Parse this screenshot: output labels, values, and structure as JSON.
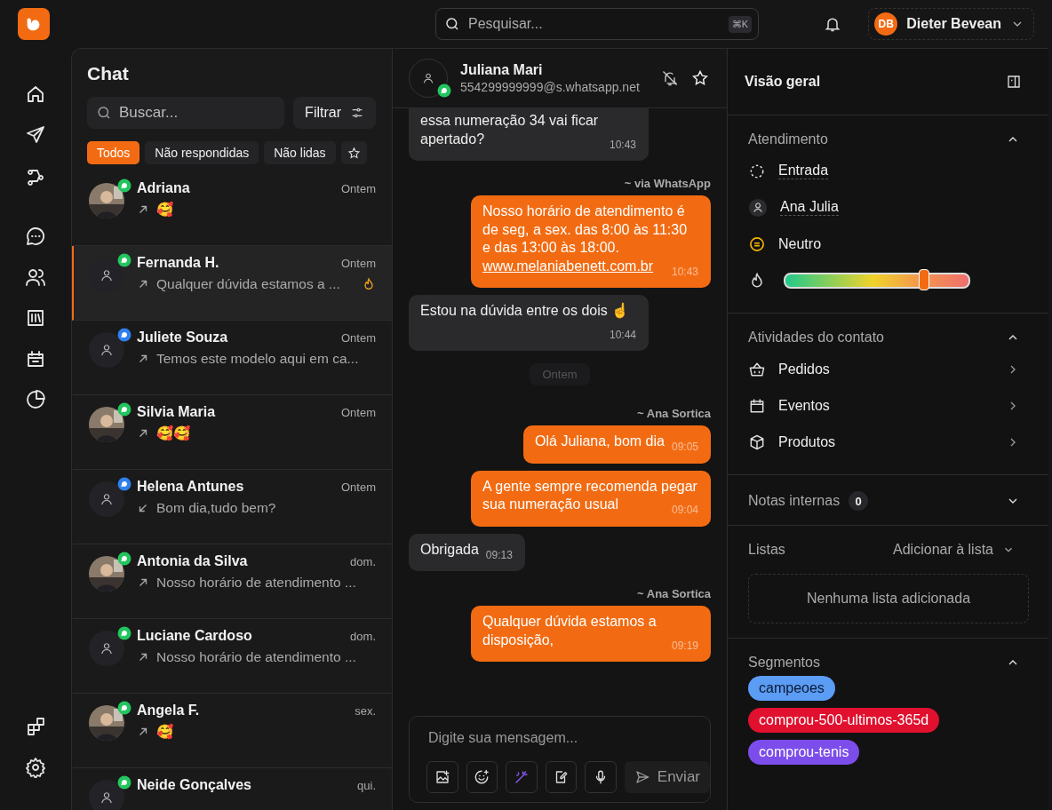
{
  "topbar": {
    "search": {
      "placeholder": "Pesquisar...",
      "shortcut": "⌘K"
    },
    "user": {
      "initials": "DB",
      "name": "Dieter Bevean"
    }
  },
  "chat_list": {
    "title": "Chat",
    "search": {
      "placeholder": "Buscar..."
    },
    "filter_button": "Filtrar",
    "tabs": [
      {
        "kind": "text",
        "label": "Todos",
        "selected": true
      },
      {
        "kind": "text",
        "label": "Não respondidas",
        "selected": false
      },
      {
        "kind": "text",
        "label": "Não lidas",
        "selected": false
      },
      {
        "kind": "starred",
        "selected": false
      }
    ],
    "conversations": [
      {
        "name": "Adriana",
        "time": "Ontem",
        "photo": true,
        "color": "#22c55e",
        "outgoing": true,
        "preview": "🥰",
        "hot": false,
        "selected": false
      },
      {
        "name": "Fernanda H.",
        "time": "Ontem",
        "photo": false,
        "color": "#22c55e",
        "outgoing": true,
        "preview": "Qualquer dúvida estamos a ...",
        "hot": true,
        "selected": true
      },
      {
        "name": "Juliete Souza",
        "time": "Ontem",
        "photo": false,
        "color": "#2f80ed",
        "outgoing": true,
        "preview": "Temos este modelo aqui em ca...",
        "hot": false,
        "selected": false
      },
      {
        "name": "Silvia Maria",
        "time": "Ontem",
        "photo": true,
        "color": "#22c55e",
        "outgoing": true,
        "preview": "🥰🥰",
        "hot": false,
        "selected": false
      },
      {
        "name": "Helena Antunes",
        "time": "Ontem",
        "photo": false,
        "color": "#2f80ed",
        "outgoing": false,
        "preview": "Bom dia,tudo bem?",
        "hot": false,
        "selected": false
      },
      {
        "name": "Antonia da Silva",
        "time": "dom.",
        "photo": true,
        "color": "#22c55e",
        "outgoing": true,
        "preview": "Nosso horário de atendimento ...",
        "hot": false,
        "selected": false
      },
      {
        "name": "Luciane Cardoso",
        "time": "dom.",
        "photo": false,
        "color": "#22c55e",
        "outgoing": true,
        "preview": "Nosso horário de atendimento ...",
        "hot": false,
        "selected": false
      },
      {
        "name": "Angela F.",
        "time": "sex.",
        "photo": true,
        "color": "#22c55e",
        "outgoing": true,
        "preview": "🥰",
        "hot": false,
        "selected": false
      },
      {
        "name": "Neide Gonçalves",
        "time": "qui.",
        "photo": false,
        "color": "#22c55e",
        "selected": false
      }
    ]
  },
  "conversation": {
    "contact": {
      "name": "Juliana Mari",
      "address": "554299999999@s.whatsapp.net"
    },
    "messages": [
      {
        "kind": "in",
        "text": "essa numeração 34 vai ficar apertado?",
        "time": "10:43"
      },
      {
        "kind": "sender",
        "text": "~ via WhatsApp"
      },
      {
        "kind": "out",
        "text": "Nosso horário de atendimento é de seg, a sex. das 8:00 às 11:30 e das 13:00 às 18:00.",
        "link": "www.melaniabenett.com.br",
        "time": "10:43"
      },
      {
        "kind": "in",
        "text": "Estou na dúvida entre os dois ☝",
        "time": "10:44"
      },
      {
        "kind": "date",
        "text": "Ontem"
      },
      {
        "kind": "sender",
        "text": "~ Ana Sortica"
      },
      {
        "kind": "out",
        "text": "Olá Juliana, bom dia",
        "time": "09:05"
      },
      {
        "kind": "out",
        "text": "A gente sempre recomenda pegar sua numeração usual",
        "time": "09:04"
      },
      {
        "kind": "in",
        "text": "Obrigada",
        "time": "09:13"
      },
      {
        "kind": "sender",
        "text": "~ Ana Sortica"
      },
      {
        "kind": "out",
        "text": "Qualquer dúvida estamos a disposição,",
        "time": "09:19"
      }
    ],
    "composer": {
      "placeholder": "Digite sua mensagem...",
      "send": "Enviar",
      "send_disabled": true
    }
  },
  "overview": {
    "title": "Visão geral",
    "attendance": {
      "title": "Atendimento",
      "expanded": true,
      "status": "Entrada",
      "agent": "Ana Julia",
      "sentiment": "Neutro",
      "temperature": {
        "level": 0.75
      }
    },
    "activities": {
      "title": "Atividades do contato",
      "expanded": true,
      "items": [
        "Pedidos",
        "Eventos",
        "Produtos"
      ]
    },
    "notes": {
      "title": "Notas internas",
      "count": "0",
      "expanded": false
    },
    "lists": {
      "title": "Listas",
      "add": "Adicionar à lista",
      "empty": "Nenhuma lista adicionada"
    },
    "segments": {
      "title": "Segmentos",
      "expanded": true,
      "tags": [
        {
          "label": "campeoes",
          "color": "#5b9cf5"
        },
        {
          "label": "comprou-500-ultimos-365d",
          "color": "#e0102e"
        },
        {
          "label": "comprou-tenis",
          "color": "#7c4dea"
        }
      ]
    }
  }
}
